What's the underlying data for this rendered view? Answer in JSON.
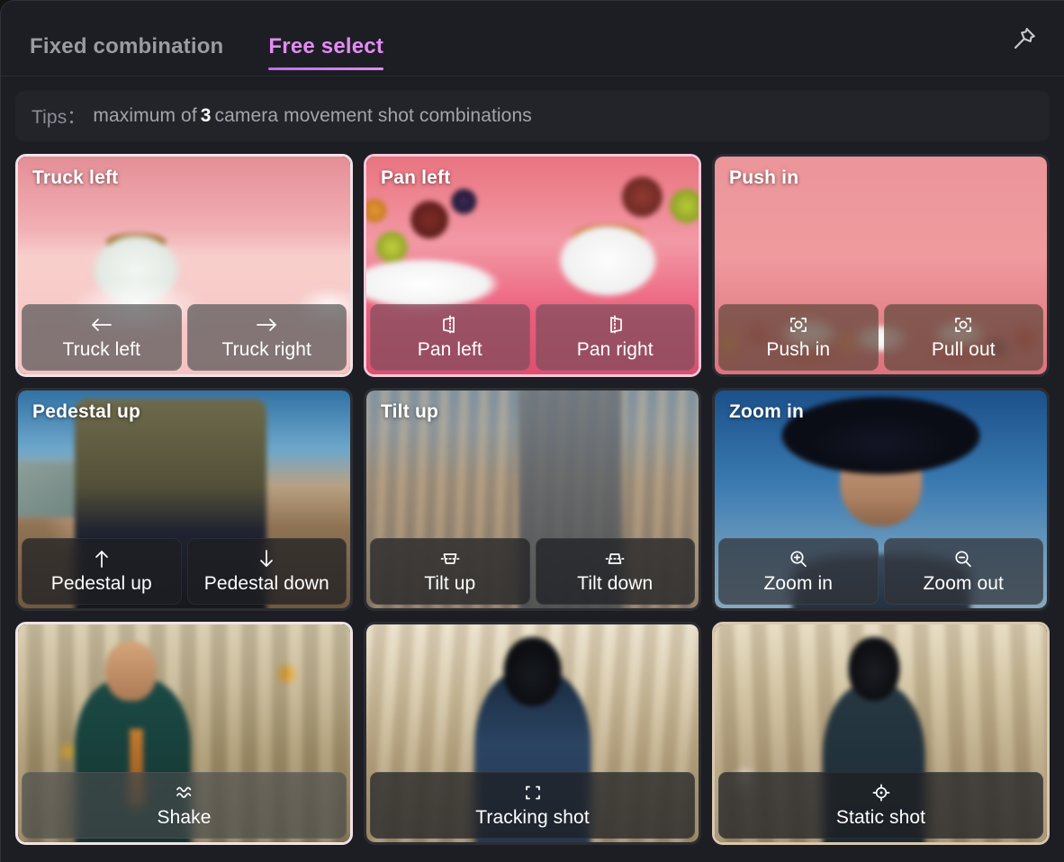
{
  "header": {
    "tabs": [
      {
        "label": "Fixed combination",
        "active": false
      },
      {
        "label": "Free select",
        "active": true
      }
    ],
    "pin_icon": "pin-icon",
    "accent_color": "#e48bf5"
  },
  "tips": {
    "label": "Tips：",
    "text_before": "maximum of",
    "count": "3",
    "text_after": "camera movement shot combinations"
  },
  "cards": [
    {
      "title": "Truck left",
      "selected": true,
      "border_color": "#f0e3e6",
      "options": [
        {
          "label": "Truck left",
          "icon": "arrow-left-icon"
        },
        {
          "label": "Truck right",
          "icon": "arrow-right-icon"
        }
      ]
    },
    {
      "title": "Pan left",
      "selected": true,
      "border_color": "#f6c7d8",
      "options": [
        {
          "label": "Pan left",
          "icon": "pan-left-icon"
        },
        {
          "label": "Pan right",
          "icon": "pan-right-icon"
        }
      ]
    },
    {
      "title": "Push in",
      "selected": false,
      "border_color": "#2c2d33",
      "options": [
        {
          "label": "Push in",
          "icon": "push-in-icon"
        },
        {
          "label": "Pull out",
          "icon": "pull-out-icon"
        }
      ]
    },
    {
      "title": "Pedestal up",
      "selected": false,
      "border_color": "#2c2d33",
      "options": [
        {
          "label": "Pedestal up",
          "icon": "arrow-up-icon"
        },
        {
          "label": "Pedestal down",
          "icon": "arrow-down-icon"
        }
      ]
    },
    {
      "title": "Tilt up",
      "selected": false,
      "border_color": "#2c2d33",
      "options": [
        {
          "label": "Tilt up",
          "icon": "tilt-up-icon"
        },
        {
          "label": "Tilt down",
          "icon": "tilt-down-icon"
        }
      ]
    },
    {
      "title": "Zoom in",
      "selected": false,
      "border_color": "#2c2d33",
      "options": [
        {
          "label": "Zoom in",
          "icon": "zoom-in-icon"
        },
        {
          "label": "Zoom out",
          "icon": "zoom-out-icon"
        }
      ]
    },
    {
      "title": "",
      "selected": true,
      "border_color": "#cfd4d2",
      "options": [
        {
          "label": "Shake",
          "icon": "shake-icon"
        }
      ]
    },
    {
      "title": "",
      "selected": false,
      "border_color": "#2c2d33",
      "options": [
        {
          "label": "Tracking shot",
          "icon": "tracking-shot-icon"
        }
      ]
    },
    {
      "title": "",
      "selected": false,
      "border_color": "#d9c7ae",
      "options": [
        {
          "label": "Static shot",
          "icon": "static-shot-icon"
        }
      ]
    }
  ]
}
